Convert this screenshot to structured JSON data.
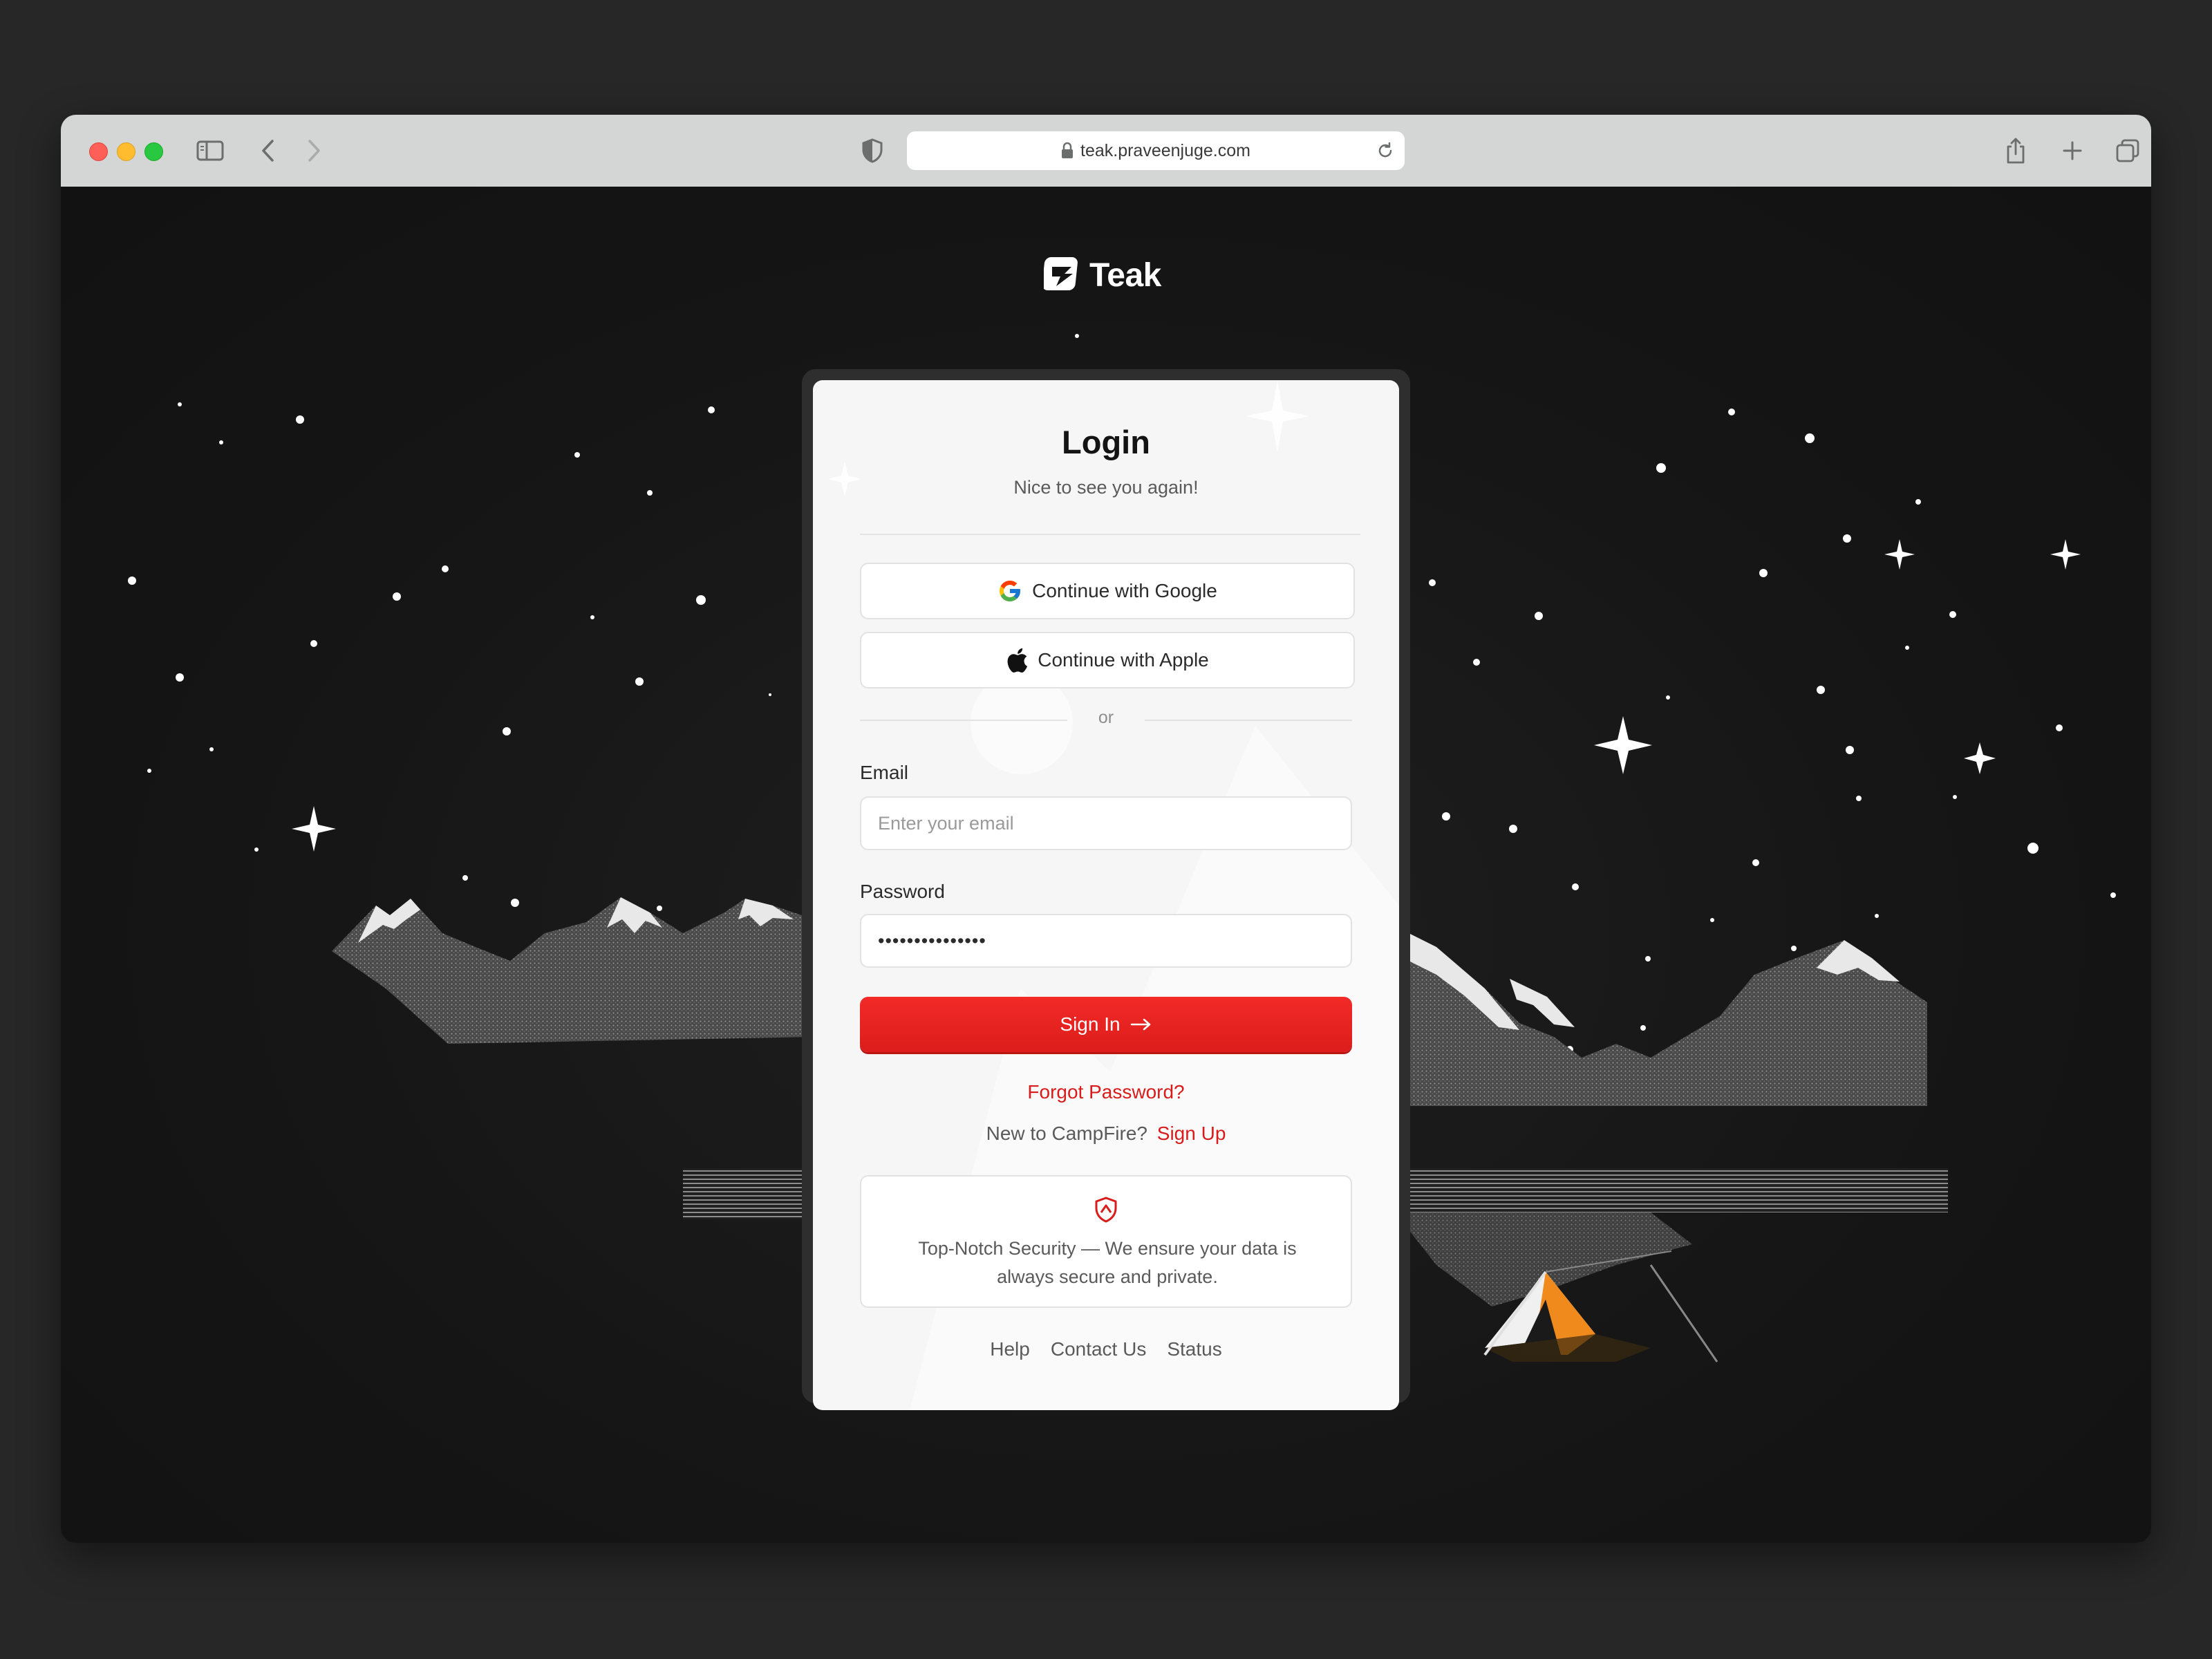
{
  "browser": {
    "url": "teak.praveenjuge.com"
  },
  "brand": {
    "name": "Teak"
  },
  "login": {
    "title": "Login",
    "subtitle": "Nice to see you again!",
    "google_label": "Continue with Google",
    "apple_label": "Continue with Apple",
    "divider_text": "or",
    "email_label": "Email",
    "email_placeholder": "Enter your email",
    "password_label": "Password",
    "password_value": "•••••••••••••••",
    "signin_label": "Sign In",
    "forgot_label": "Forgot Password?",
    "signup_prompt": "New to CampFire?",
    "signup_label": "Sign Up",
    "security_text": "Top-Notch Security — We ensure your data is always secure and private."
  },
  "footer": {
    "help": "Help",
    "contact": "Contact Us",
    "status": "Status"
  },
  "colors": {
    "accent": "#e0201e",
    "page_bg": "#141414",
    "card_bg": "#f6f6f6",
    "tent": "#f08a1c"
  }
}
